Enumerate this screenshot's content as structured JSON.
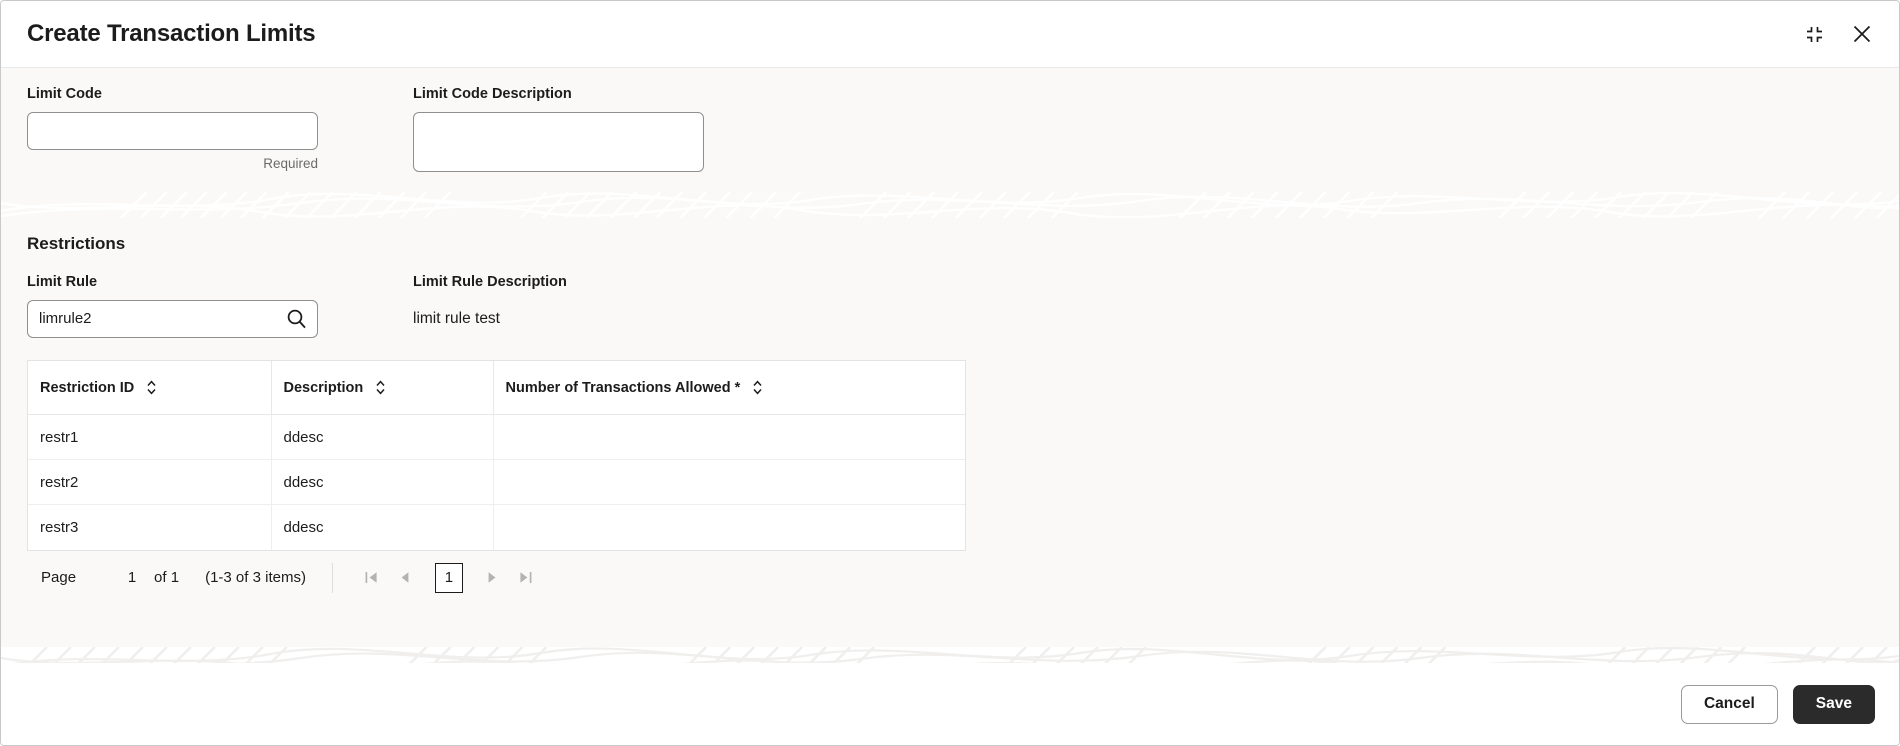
{
  "window": {
    "title": "Create Transaction Limits",
    "minimize_icon": "collapse-icon",
    "close_icon": "close-icon"
  },
  "form": {
    "limit_code": {
      "label": "Limit Code",
      "value": "",
      "placeholder": "",
      "hint": "Required"
    },
    "limit_code_description": {
      "label": "Limit Code Description",
      "value": "",
      "placeholder": ""
    }
  },
  "restrictions": {
    "section_title": "Restrictions",
    "limit_rule": {
      "label": "Limit Rule",
      "value": "limrule2",
      "placeholder": "",
      "search_icon": "search-icon"
    },
    "limit_rule_description": {
      "label": "Limit Rule Description",
      "value": "limit rule test"
    },
    "table": {
      "columns": [
        {
          "label": "Restriction ID",
          "sortable": true
        },
        {
          "label": "Description",
          "sortable": true
        },
        {
          "label": "Number of Transactions Allowed *",
          "sortable": true
        }
      ],
      "rows": [
        {
          "restriction_id": "restr1",
          "description": "ddesc",
          "number_of_transactions_allowed": ""
        },
        {
          "restriction_id": "restr2",
          "description": "ddesc",
          "number_of_transactions_allowed": ""
        },
        {
          "restriction_id": "restr3",
          "description": "ddesc",
          "number_of_transactions_allowed": ""
        }
      ]
    },
    "pagination": {
      "page_label": "Page",
      "page_value": "1",
      "of_label": "of 1",
      "items_label": "(1-3 of 3 items)",
      "current_page": "1",
      "first_icon": "first-page-icon",
      "prev_icon": "previous-page-icon",
      "next_icon": "next-page-icon",
      "last_icon": "last-page-icon"
    }
  },
  "footer": {
    "cancel_label": "Cancel",
    "save_label": "Save"
  },
  "colors": {
    "header_bg": "#ffffff",
    "body_bg": "#faf9f7",
    "primary_button_bg": "#2b2b2b",
    "text": "#1c1c1c",
    "muted_text": "#6b6b6b",
    "border": "#e3e3e3",
    "disabled_arrow": "#b3b3b3"
  }
}
